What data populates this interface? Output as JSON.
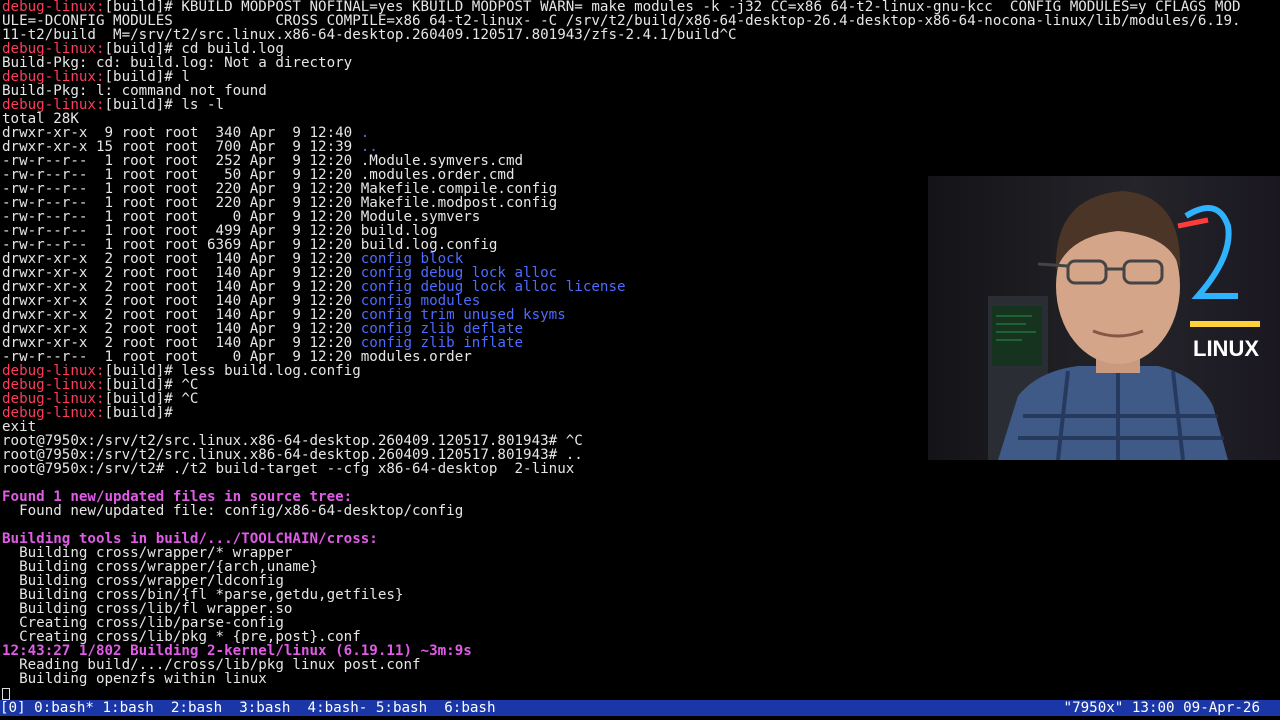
{
  "terminal_lines": [
    {
      "segments": [
        {
          "t": "debug-linux:",
          "c": "prompt"
        },
        {
          "t": "[build]# KBUILD_MODPOST_NOFINAL=yes KBUILD_MODPOST_WARN= make modules -k -j32 CC=x86_64-t2-linux-gnu-kcc  CONFIG_MODULES=y CFLAGS_MOD",
          "c": "plain"
        }
      ]
    },
    {
      "segments": [
        {
          "t": "ULE=-DCONFIG_MODULES            CROSS_COMPILE=x86_64-t2-linux- -C /srv/t2/build/x86-64-desktop-26.4-desktop-x86-64-nocona-linux/lib/modules/6.19.",
          "c": "plain"
        }
      ]
    },
    {
      "segments": [
        {
          "t": "11-t2/build  M=/srv/t2/src.linux.x86-64-desktop.260409.120517.801943/zfs-2.4.1/build^C",
          "c": "plain"
        }
      ]
    },
    {
      "segments": [
        {
          "t": "debug-linux:",
          "c": "prompt"
        },
        {
          "t": "[build]# cd build.log",
          "c": "plain"
        }
      ]
    },
    {
      "segments": [
        {
          "t": "Build-Pkg: cd: build.log: Not a directory",
          "c": "plain"
        }
      ]
    },
    {
      "segments": [
        {
          "t": "debug-linux:",
          "c": "prompt"
        },
        {
          "t": "[build]# l",
          "c": "plain"
        }
      ]
    },
    {
      "segments": [
        {
          "t": "Build-Pkg: l: command not found",
          "c": "plain"
        }
      ]
    },
    {
      "segments": [
        {
          "t": "debug-linux:",
          "c": "prompt"
        },
        {
          "t": "[build]# ls -l",
          "c": "plain"
        }
      ]
    },
    {
      "segments": [
        {
          "t": "total 28K",
          "c": "plain"
        }
      ]
    },
    {
      "segments": [
        {
          "t": "drwxr-xr-x  9 root root  340 Apr  9 12:40 ",
          "c": "plain"
        },
        {
          "t": ".",
          "c": "dir"
        }
      ]
    },
    {
      "segments": [
        {
          "t": "drwxr-xr-x 15 root root  700 Apr  9 12:39 ",
          "c": "plain"
        },
        {
          "t": "..",
          "c": "dir"
        }
      ]
    },
    {
      "segments": [
        {
          "t": "-rw-r--r--  1 root root  252 Apr  9 12:20 .Module.symvers.cmd",
          "c": "plain"
        }
      ]
    },
    {
      "segments": [
        {
          "t": "-rw-r--r--  1 root root   50 Apr  9 12:20 .modules.order.cmd",
          "c": "plain"
        }
      ]
    },
    {
      "segments": [
        {
          "t": "-rw-r--r--  1 root root  220 Apr  9 12:20 Makefile.compile.config",
          "c": "plain"
        }
      ]
    },
    {
      "segments": [
        {
          "t": "-rw-r--r--  1 root root  220 Apr  9 12:20 Makefile.modpost.config",
          "c": "plain"
        }
      ]
    },
    {
      "segments": [
        {
          "t": "-rw-r--r--  1 root root    0 Apr  9 12:20 Module.symvers",
          "c": "plain"
        }
      ]
    },
    {
      "segments": [
        {
          "t": "-rw-r--r--  1 root root  499 Apr  9 12:20 build.log",
          "c": "plain"
        }
      ]
    },
    {
      "segments": [
        {
          "t": "-rw-r--r--  1 root root 6369 Apr  9 12:20 build.log.config",
          "c": "plain"
        }
      ]
    },
    {
      "segments": [
        {
          "t": "drwxr-xr-x  2 root root  140 Apr  9 12:20 ",
          "c": "plain"
        },
        {
          "t": "config_block",
          "c": "dir"
        }
      ]
    },
    {
      "segments": [
        {
          "t": "drwxr-xr-x  2 root root  140 Apr  9 12:20 ",
          "c": "plain"
        },
        {
          "t": "config_debug_lock_alloc",
          "c": "dir"
        }
      ]
    },
    {
      "segments": [
        {
          "t": "drwxr-xr-x  2 root root  140 Apr  9 12:20 ",
          "c": "plain"
        },
        {
          "t": "config_debug_lock_alloc_license",
          "c": "dir"
        }
      ]
    },
    {
      "segments": [
        {
          "t": "drwxr-xr-x  2 root root  140 Apr  9 12:20 ",
          "c": "plain"
        },
        {
          "t": "config_modules",
          "c": "dir"
        }
      ]
    },
    {
      "segments": [
        {
          "t": "drwxr-xr-x  2 root root  140 Apr  9 12:20 ",
          "c": "plain"
        },
        {
          "t": "config_trim_unused_ksyms",
          "c": "dir"
        }
      ]
    },
    {
      "segments": [
        {
          "t": "drwxr-xr-x  2 root root  140 Apr  9 12:20 ",
          "c": "plain"
        },
        {
          "t": "config_zlib_deflate",
          "c": "dir"
        }
      ]
    },
    {
      "segments": [
        {
          "t": "drwxr-xr-x  2 root root  140 Apr  9 12:20 ",
          "c": "plain"
        },
        {
          "t": "config_zlib_inflate",
          "c": "dir"
        }
      ]
    },
    {
      "segments": [
        {
          "t": "-rw-r--r--  1 root root    0 Apr  9 12:20 modules.order",
          "c": "plain"
        }
      ]
    },
    {
      "segments": [
        {
          "t": "debug-linux:",
          "c": "prompt"
        },
        {
          "t": "[build]# less build.log.config",
          "c": "plain"
        }
      ]
    },
    {
      "segments": [
        {
          "t": "debug-linux:",
          "c": "prompt"
        },
        {
          "t": "[build]# ^C",
          "c": "plain"
        }
      ]
    },
    {
      "segments": [
        {
          "t": "debug-linux:",
          "c": "prompt"
        },
        {
          "t": "[build]# ^C",
          "c": "plain"
        }
      ]
    },
    {
      "segments": [
        {
          "t": "debug-linux:",
          "c": "prompt"
        },
        {
          "t": "[build]#",
          "c": "plain"
        }
      ]
    },
    {
      "segments": [
        {
          "t": "exit",
          "c": "plain"
        }
      ]
    },
    {
      "segments": [
        {
          "t": "root@7950x:/srv/t2/src.linux.x86-64-desktop.260409.120517.801943# ^C",
          "c": "plain"
        }
      ]
    },
    {
      "segments": [
        {
          "t": "root@7950x:/srv/t2/src.linux.x86-64-desktop.260409.120517.801943# ..",
          "c": "plain"
        }
      ]
    },
    {
      "segments": [
        {
          "t": "root@7950x:/srv/t2# ./t2 build-target --cfg x86-64-desktop  2-linux",
          "c": "plain"
        }
      ]
    },
    {
      "segments": []
    },
    {
      "segments": [
        {
          "t": "Found 1 new/updated files in source tree:",
          "c": "head"
        }
      ]
    },
    {
      "segments": [
        {
          "t": "  Found new/updated file: config/x86-64-desktop/config",
          "c": "plain"
        }
      ]
    },
    {
      "segments": []
    },
    {
      "segments": [
        {
          "t": "Building tools in build/.../TOOLCHAIN/cross:",
          "c": "head"
        }
      ]
    },
    {
      "segments": [
        {
          "t": "  Building cross/wrapper/*_wrapper",
          "c": "plain"
        }
      ]
    },
    {
      "segments": [
        {
          "t": "  Building cross/wrapper/{arch,uname}",
          "c": "plain"
        }
      ]
    },
    {
      "segments": [
        {
          "t": "  Building cross/wrapper/ldconfig",
          "c": "plain"
        }
      ]
    },
    {
      "segments": [
        {
          "t": "  Building cross/bin/{fl_*parse,getdu,getfiles}",
          "c": "plain"
        }
      ]
    },
    {
      "segments": [
        {
          "t": "  Building cross/lib/fl_wrapper.so",
          "c": "plain"
        }
      ]
    },
    {
      "segments": [
        {
          "t": "  Creating cross/lib/parse-config",
          "c": "plain"
        }
      ]
    },
    {
      "segments": [
        {
          "t": "  Creating cross/lib/pkg_*_{pre,post}.conf",
          "c": "plain"
        }
      ]
    },
    {
      "segments": [
        {
          "t": "12:43:27 1/802 Building 2-kernel/linux (6.19.11) ~3m:9s",
          "c": "head"
        }
      ]
    },
    {
      "segments": [
        {
          "t": "  Reading build/.../cross/lib/pkg_linux_post.conf",
          "c": "plain"
        }
      ]
    },
    {
      "segments": [
        {
          "t": "  Building openzfs within linux",
          "c": "plain"
        }
      ]
    }
  ],
  "statusbar": {
    "session": "[0]",
    "windows": [
      {
        "label": "0:bash*"
      },
      {
        "label": "1:bash"
      },
      {
        "label": "2:bash"
      },
      {
        "label": "3:bash"
      },
      {
        "label": "4:bash-"
      },
      {
        "label": "5:bash"
      },
      {
        "label": "6:bash"
      }
    ],
    "right": "\"7950x\" 13:00 09-Apr-26"
  },
  "webcam": {
    "sign_text": "LINUX",
    "sign_number": "2"
  },
  "colors": {
    "prompt": "#ff3b5c",
    "dir": "#4d6bff",
    "heading": "#e05ce6",
    "statusbar_bg": "#1b36a6"
  }
}
